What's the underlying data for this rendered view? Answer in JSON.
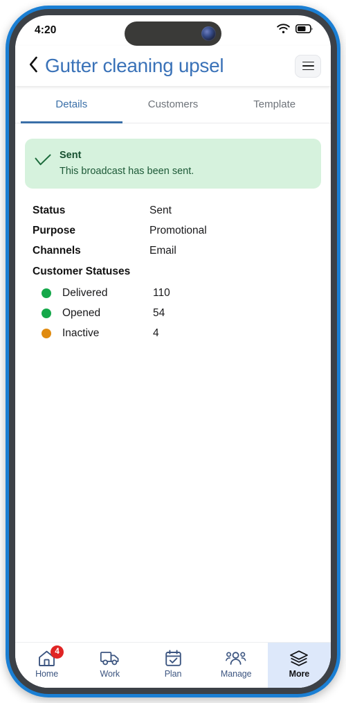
{
  "status_bar": {
    "time": "4:20",
    "wifi_icon": "wifi-icon",
    "battery_icon": "battery-icon"
  },
  "header": {
    "back_icon": "chevron-left-icon",
    "title": "Gutter cleaning upsel",
    "menu_icon": "hamburger-menu-icon"
  },
  "tabs": [
    {
      "label": "Details",
      "active": true
    },
    {
      "label": "Customers",
      "active": false
    },
    {
      "label": "Template",
      "active": false
    }
  ],
  "alert": {
    "icon": "check-icon",
    "title": "Sent",
    "message": "This broadcast has been sent.",
    "background_color": "#d6f2dd",
    "text_color": "#16502f"
  },
  "details": [
    {
      "label": "Status",
      "value": "Sent"
    },
    {
      "label": "Purpose",
      "value": "Promotional"
    },
    {
      "label": "Channels",
      "value": "Email"
    }
  ],
  "customer_statuses": {
    "heading": "Customer Statuses",
    "rows": [
      {
        "name": "Delivered",
        "count": "110",
        "color": "#15a84a"
      },
      {
        "name": "Opened",
        "count": "54",
        "color": "#15a84a"
      },
      {
        "name": "Inactive",
        "count": "4",
        "color": "#e08b10"
      }
    ]
  },
  "bottom_nav": {
    "active_background": "#dde8fa",
    "items": [
      {
        "label": "Home",
        "icon": "home-icon",
        "badge": "4",
        "active": false
      },
      {
        "label": "Work",
        "icon": "truck-icon",
        "badge": "",
        "active": false
      },
      {
        "label": "Plan",
        "icon": "calendar-check-icon",
        "badge": "",
        "active": false
      },
      {
        "label": "Manage",
        "icon": "people-group-icon",
        "badge": "",
        "active": false
      },
      {
        "label": "More",
        "icon": "layers-icon",
        "badge": "",
        "active": true
      }
    ]
  }
}
